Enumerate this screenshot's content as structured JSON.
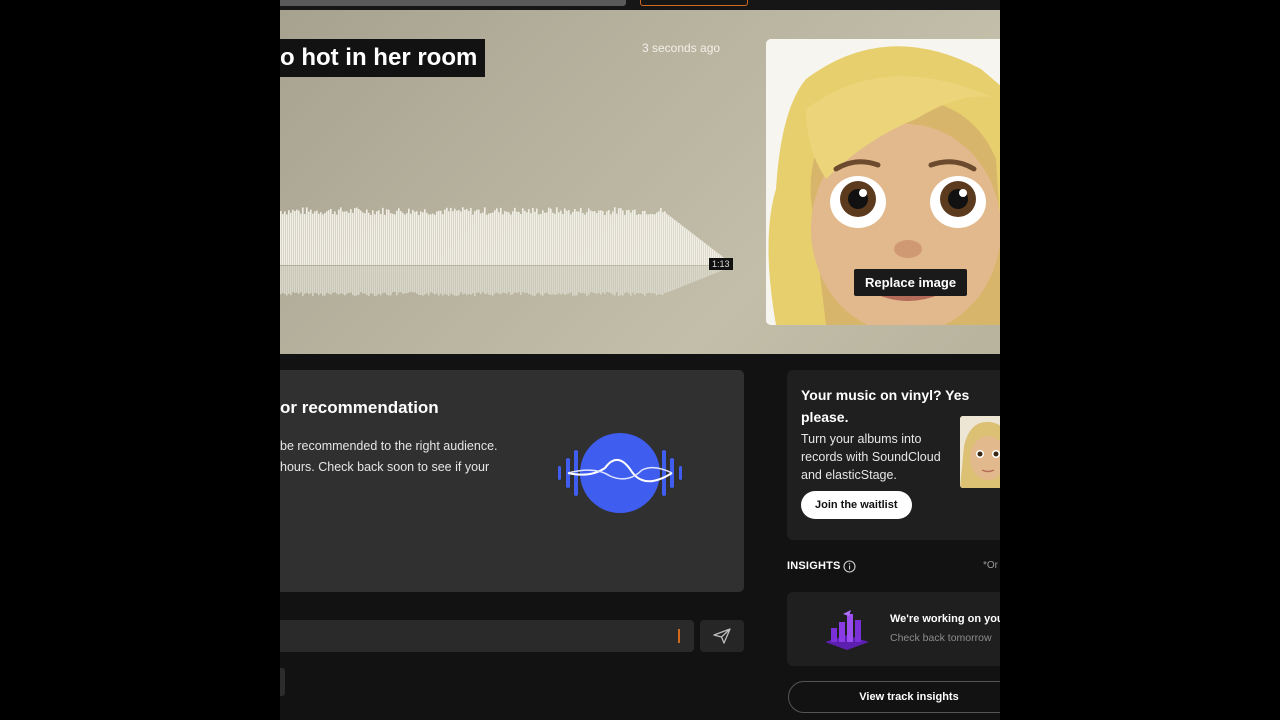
{
  "track": {
    "title": "o hot in her room",
    "uploaded_ago": "3 seconds ago",
    "duration": "1:13"
  },
  "artwork": {
    "replace_label": "Replace image"
  },
  "recommendation": {
    "title": "or recommendation",
    "text_line1": "be recommended to the right audience.",
    "text_line2": "hours. Check back soon to see if your"
  },
  "comment": {
    "placeholder": ""
  },
  "vinyl_promo": {
    "title": "Your music on vinyl? Yes please.",
    "body": "Turn your albums into records with SoundCloud and elasticStage.",
    "button_label": "Join the waitlist"
  },
  "insights": {
    "label": "INSIGHTS",
    "right_text": "*Or",
    "card_title": "We're working on you",
    "card_subtitle": "Check back tomorrow",
    "view_button": "View track insights"
  },
  "colors": {
    "accent": "#d2691e",
    "reco_icon_blue": "#3f5ef0",
    "insights_purple": "#7b2fd6"
  }
}
